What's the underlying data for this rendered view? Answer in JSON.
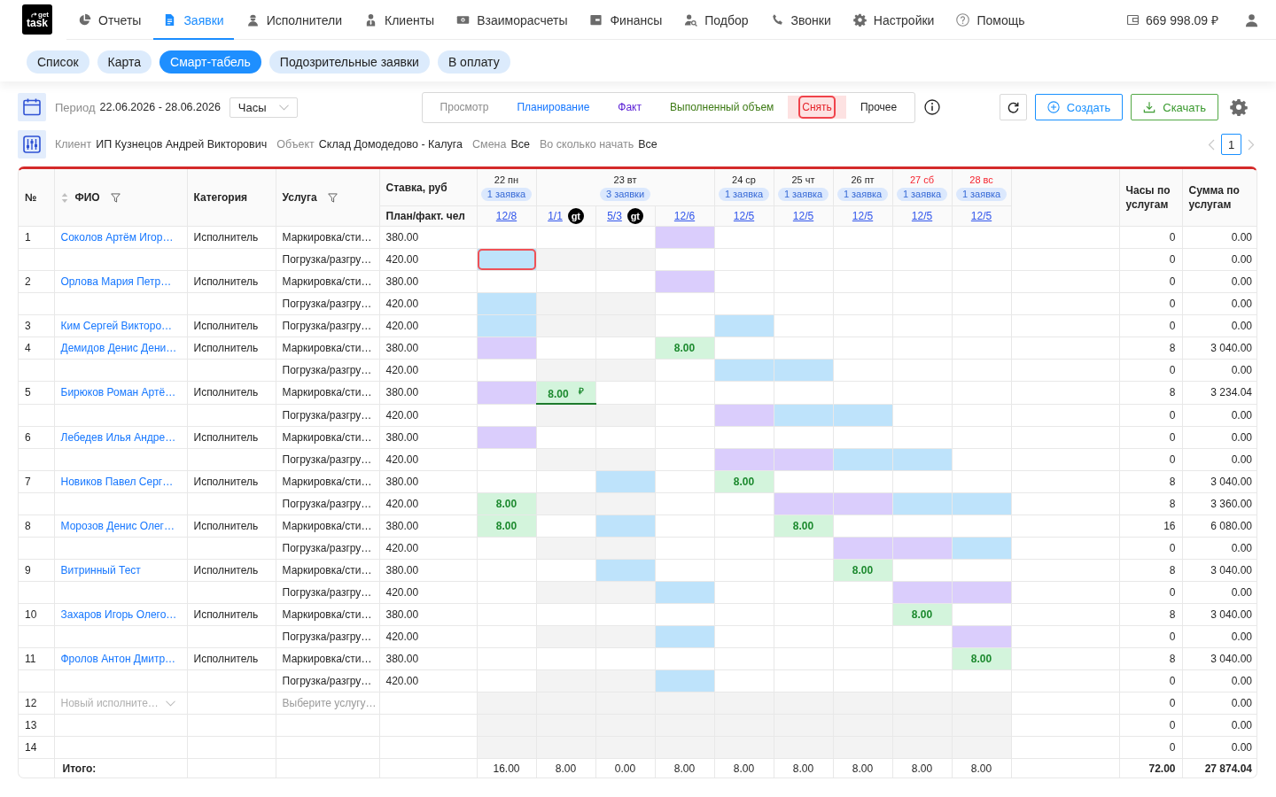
{
  "logo": {
    "top": "get",
    "bottom": "task"
  },
  "nav": {
    "items": [
      {
        "label": "Отчеты",
        "selected": false
      },
      {
        "label": "Заявки",
        "selected": true
      },
      {
        "label": "Исполнители",
        "selected": false
      },
      {
        "label": "Клиенты",
        "selected": false
      },
      {
        "label": "Взаиморасчеты",
        "selected": false
      },
      {
        "label": "Финансы",
        "selected": false
      },
      {
        "label": "Подбор",
        "selected": false
      },
      {
        "label": "Звонки",
        "selected": false
      },
      {
        "label": "Настройки",
        "selected": false
      },
      {
        "label": "Помощь",
        "selected": false
      }
    ]
  },
  "balance": {
    "amount": "669 998.09 ₽"
  },
  "subtabs": [
    {
      "label": "Список",
      "selected": false
    },
    {
      "label": "Карта",
      "selected": false
    },
    {
      "label": "Смарт-табель",
      "selected": true
    },
    {
      "label": "Подозрительные заявки",
      "selected": false
    },
    {
      "label": "В оплату",
      "selected": false
    }
  ],
  "toolbar": {
    "period": {
      "label": "Период",
      "value": "22.06.2026 - 28.06.2026"
    },
    "unit_select": {
      "value": "Часы"
    },
    "modes": [
      {
        "label": "Просмотр",
        "selected": false,
        "color": "#8c8c8c"
      },
      {
        "label": "Планирование",
        "selected": false,
        "color": "#1677ff"
      },
      {
        "label": "Факт",
        "selected": false,
        "color": "#5b21d6"
      },
      {
        "label": "Выполненный объем",
        "selected": false,
        "color": "#3d7a14"
      },
      {
        "label": "Снять",
        "selected": true,
        "color": "#e5242b"
      },
      {
        "label": "Прочее",
        "selected": false,
        "color": "#1f1f1f"
      }
    ],
    "create_button": "Создать",
    "download_button": "Скачать"
  },
  "filters": [
    {
      "label": "Клиент",
      "value": "ИП Кузнецов Андрей Викторович"
    },
    {
      "label": "Объект",
      "value": "Склад Домодедово - Калуга"
    },
    {
      "label": "Смена",
      "value": "Все"
    },
    {
      "label": "Во сколько начать",
      "value": "Все"
    }
  ],
  "pagination": {
    "pages": [
      {
        "label": "1",
        "selected": true
      }
    ]
  },
  "table": {
    "columns": {
      "number": "№",
      "name": "ФИО",
      "category": "Категория",
      "service": "Услуга",
      "rate": "Ставка, руб",
      "plan_fact": "План/факт. чел",
      "hours": "Часы по услугам",
      "sum": "Сумма по услугам"
    },
    "days": [
      {
        "label": "22 пн",
        "orders": "1 заявка",
        "weekend": false,
        "slots": [
          {
            "ratio": "12/8"
          }
        ]
      },
      {
        "label": "23 вт",
        "orders": "3 заявки",
        "weekend": false,
        "slots": [
          {
            "ratio": "1/1",
            "badge": "gt"
          },
          {
            "ratio": "5/3",
            "badge": "gt"
          },
          {
            "ratio": "12/6"
          }
        ]
      },
      {
        "label": "24 ср",
        "orders": "1 заявка",
        "weekend": false,
        "slots": [
          {
            "ratio": "12/5"
          }
        ]
      },
      {
        "label": "25 чт",
        "orders": "1 заявка",
        "weekend": false,
        "slots": [
          {
            "ratio": "12/5"
          }
        ]
      },
      {
        "label": "26 пт",
        "orders": "1 заявка",
        "weekend": false,
        "slots": [
          {
            "ratio": "12/5"
          }
        ]
      },
      {
        "label": "27 сб",
        "orders": "1 заявка",
        "weekend": true,
        "slots": [
          {
            "ratio": "12/5"
          }
        ]
      },
      {
        "label": "28 вс",
        "orders": "1 заявка",
        "weekend": true,
        "slots": [
          {
            "ratio": "12/5"
          }
        ]
      }
    ],
    "rows": [
      {
        "number": "1",
        "name": "Соколов Артём Игор…",
        "category": "Исполнитель",
        "service": "Маркировка/сти…",
        "rate": "380.00",
        "hours": "0",
        "sum": "0.00",
        "cells": [
          {
            "kind": "empty",
            "selected": false
          },
          {
            "kind": "empty",
            "selected": false
          },
          {
            "kind": "empty",
            "selected": false
          },
          {
            "kind": "fact",
            "selected": false
          },
          {
            "kind": "empty",
            "selected": false
          },
          {
            "kind": "empty",
            "selected": false
          },
          {
            "kind": "empty",
            "selected": false
          },
          {
            "kind": "empty",
            "selected": false
          },
          {
            "kind": "empty",
            "selected": false
          }
        ]
      },
      {
        "service": "Погрузка/разгру…",
        "rate": "420.00",
        "hours": "0",
        "sum": "0.00",
        "cells": [
          {
            "kind": "plan",
            "selected": true
          },
          {
            "kind": "unavailable",
            "selected": false
          },
          {
            "kind": "unavailable",
            "selected": false
          },
          {
            "kind": "empty",
            "selected": false
          },
          {
            "kind": "empty",
            "selected": false
          },
          {
            "kind": "empty",
            "selected": false
          },
          {
            "kind": "empty",
            "selected": false
          },
          {
            "kind": "empty",
            "selected": false
          },
          {
            "kind": "empty",
            "selected": false
          }
        ]
      },
      {
        "number": "2",
        "name": "Орлова Мария Петр…",
        "category": "Исполнитель",
        "service": "Маркировка/сти…",
        "rate": "380.00",
        "hours": "0",
        "sum": "0.00",
        "cells": [
          {
            "kind": "empty",
            "selected": false
          },
          {
            "kind": "empty",
            "selected": false
          },
          {
            "kind": "empty",
            "selected": false
          },
          {
            "kind": "fact",
            "selected": false
          },
          {
            "kind": "empty",
            "selected": false
          },
          {
            "kind": "empty",
            "selected": false
          },
          {
            "kind": "empty",
            "selected": false
          },
          {
            "kind": "empty",
            "selected": false
          },
          {
            "kind": "empty",
            "selected": false
          }
        ]
      },
      {
        "service": "Погрузка/разгру…",
        "rate": "420.00",
        "hours": "0",
        "sum": "0.00",
        "cells": [
          {
            "kind": "plan",
            "selected": false
          },
          {
            "kind": "unavailable",
            "selected": false
          },
          {
            "kind": "unavailable",
            "selected": false
          },
          {
            "kind": "empty",
            "selected": false
          },
          {
            "kind": "empty",
            "selected": false
          },
          {
            "kind": "empty",
            "selected": false
          },
          {
            "kind": "empty",
            "selected": false
          },
          {
            "kind": "empty",
            "selected": false
          },
          {
            "kind": "empty",
            "selected": false
          }
        ]
      },
      {
        "number": "3",
        "name": "Ким Сергей Викторо…",
        "category": "Исполнитель",
        "service": "Погрузка/разгру…",
        "rate": "420.00",
        "hours": "0",
        "sum": "0.00",
        "cells": [
          {
            "kind": "plan",
            "selected": false
          },
          {
            "kind": "unavailable",
            "selected": false
          },
          {
            "kind": "unavailable",
            "selected": false
          },
          {
            "kind": "empty",
            "selected": false
          },
          {
            "kind": "plan",
            "selected": false
          },
          {
            "kind": "empty",
            "selected": false
          },
          {
            "kind": "empty",
            "selected": false
          },
          {
            "kind": "empty",
            "selected": false
          },
          {
            "kind": "empty",
            "selected": false
          }
        ]
      },
      {
        "number": "4",
        "name": "Демидов Денис Дени…",
        "category": "Исполнитель",
        "service": "Маркировка/сти…",
        "rate": "380.00",
        "hours": "8",
        "sum": "3 040.00",
        "cells": [
          {
            "kind": "fact",
            "selected": false
          },
          {
            "kind": "empty",
            "selected": false
          },
          {
            "kind": "empty",
            "selected": false
          },
          {
            "kind": "volume",
            "value": "8.00",
            "selected": false
          },
          {
            "kind": "empty",
            "selected": false
          },
          {
            "kind": "empty",
            "selected": false
          },
          {
            "kind": "empty",
            "selected": false
          },
          {
            "kind": "empty",
            "selected": false
          },
          {
            "kind": "empty",
            "selected": false
          }
        ]
      },
      {
        "service": "Погрузка/разгру…",
        "rate": "420.00",
        "hours": "0",
        "sum": "0.00",
        "cells": [
          {
            "kind": "empty",
            "selected": false
          },
          {
            "kind": "unavailable",
            "selected": false
          },
          {
            "kind": "unavailable",
            "selected": false
          },
          {
            "kind": "empty",
            "selected": false
          },
          {
            "kind": "plan",
            "selected": false
          },
          {
            "kind": "plan",
            "selected": false
          },
          {
            "kind": "empty",
            "selected": false
          },
          {
            "kind": "empty",
            "selected": false
          },
          {
            "kind": "empty",
            "selected": false
          }
        ]
      },
      {
        "number": "5",
        "name": "Бирюков Роман Артё…",
        "category": "Исполнитель",
        "service": "Маркировка/сти…",
        "rate": "380.00",
        "hours": "8",
        "sum": "3 234.04",
        "cells": [
          {
            "kind": "fact",
            "selected": false
          },
          {
            "kind": "volume",
            "value": "8.00",
            "currency": "₽",
            "selected": false
          },
          {
            "kind": "empty",
            "selected": false
          },
          {
            "kind": "empty",
            "selected": false
          },
          {
            "kind": "empty",
            "selected": false
          },
          {
            "kind": "empty",
            "selected": false
          },
          {
            "kind": "empty",
            "selected": false
          },
          {
            "kind": "empty",
            "selected": false
          },
          {
            "kind": "empty",
            "selected": false
          }
        ]
      },
      {
        "service": "Погрузка/разгру…",
        "rate": "420.00",
        "hours": "0",
        "sum": "0.00",
        "cells": [
          {
            "kind": "empty",
            "selected": false
          },
          {
            "kind": "unavailable",
            "selected": false
          },
          {
            "kind": "unavailable",
            "selected": false
          },
          {
            "kind": "empty",
            "selected": false
          },
          {
            "kind": "fact",
            "selected": false
          },
          {
            "kind": "plan",
            "selected": false
          },
          {
            "kind": "plan",
            "selected": false
          },
          {
            "kind": "empty",
            "selected": false
          },
          {
            "kind": "empty",
            "selected": false
          }
        ]
      },
      {
        "number": "6",
        "name": "Лебедев Илья Андре…",
        "category": "Исполнитель",
        "service": "Маркировка/сти…",
        "rate": "380.00",
        "hours": "0",
        "sum": "0.00",
        "cells": [
          {
            "kind": "fact",
            "selected": false
          },
          {
            "kind": "empty",
            "selected": false
          },
          {
            "kind": "empty",
            "selected": false
          },
          {
            "kind": "empty",
            "selected": false
          },
          {
            "kind": "empty",
            "selected": false
          },
          {
            "kind": "empty",
            "selected": false
          },
          {
            "kind": "empty",
            "selected": false
          },
          {
            "kind": "empty",
            "selected": false
          },
          {
            "kind": "empty",
            "selected": false
          }
        ]
      },
      {
        "service": "Погрузка/разгру…",
        "rate": "420.00",
        "hours": "0",
        "sum": "0.00",
        "cells": [
          {
            "kind": "empty",
            "selected": false
          },
          {
            "kind": "unavailable",
            "selected": false
          },
          {
            "kind": "unavailable",
            "selected": false
          },
          {
            "kind": "empty",
            "selected": false
          },
          {
            "kind": "fact",
            "selected": false
          },
          {
            "kind": "fact",
            "selected": false
          },
          {
            "kind": "plan",
            "selected": false
          },
          {
            "kind": "plan",
            "selected": false
          },
          {
            "kind": "empty",
            "selected": false
          }
        ]
      },
      {
        "number": "7",
        "name": "Новиков Павел Серг…",
        "category": "Исполнитель",
        "service": "Маркировка/сти…",
        "rate": "380.00",
        "hours": "8",
        "sum": "3 040.00",
        "cells": [
          {
            "kind": "empty",
            "selected": false
          },
          {
            "kind": "empty",
            "selected": false
          },
          {
            "kind": "plan",
            "selected": false
          },
          {
            "kind": "empty",
            "selected": false
          },
          {
            "kind": "volume",
            "value": "8.00",
            "selected": false
          },
          {
            "kind": "empty",
            "selected": false
          },
          {
            "kind": "empty",
            "selected": false
          },
          {
            "kind": "empty",
            "selected": false
          },
          {
            "kind": "empty",
            "selected": false
          }
        ]
      },
      {
        "service": "Погрузка/разгру…",
        "rate": "420.00",
        "hours": "8",
        "sum": "3 360.00",
        "cells": [
          {
            "kind": "volume",
            "value": "8.00",
            "selected": false
          },
          {
            "kind": "unavailable",
            "selected": false
          },
          {
            "kind": "unavailable",
            "selected": false
          },
          {
            "kind": "empty",
            "selected": false
          },
          {
            "kind": "empty",
            "selected": false
          },
          {
            "kind": "fact",
            "selected": false
          },
          {
            "kind": "fact",
            "selected": false
          },
          {
            "kind": "plan",
            "selected": false
          },
          {
            "kind": "plan",
            "selected": false
          }
        ]
      },
      {
        "number": "8",
        "name": "Морозов Денис Олег…",
        "category": "Исполнитель",
        "service": "Маркировка/сти…",
        "rate": "380.00",
        "hours": "16",
        "sum": "6 080.00",
        "cells": [
          {
            "kind": "volume",
            "value": "8.00",
            "selected": false
          },
          {
            "kind": "empty",
            "selected": false
          },
          {
            "kind": "plan",
            "selected": false
          },
          {
            "kind": "empty",
            "selected": false
          },
          {
            "kind": "empty",
            "selected": false
          },
          {
            "kind": "volume",
            "value": "8.00",
            "selected": false
          },
          {
            "kind": "empty",
            "selected": false
          },
          {
            "kind": "empty",
            "selected": false
          },
          {
            "kind": "empty",
            "selected": false
          }
        ]
      },
      {
        "service": "Погрузка/разгру…",
        "rate": "420.00",
        "hours": "0",
        "sum": "0.00",
        "cells": [
          {
            "kind": "empty",
            "selected": false
          },
          {
            "kind": "unavailable",
            "selected": false
          },
          {
            "kind": "unavailable",
            "selected": false
          },
          {
            "kind": "empty",
            "selected": false
          },
          {
            "kind": "empty",
            "selected": false
          },
          {
            "kind": "empty",
            "selected": false
          },
          {
            "kind": "fact",
            "selected": false
          },
          {
            "kind": "fact",
            "selected": false
          },
          {
            "kind": "plan",
            "selected": false
          }
        ]
      },
      {
        "number": "9",
        "name": "Витринный Тест",
        "category": "Исполнитель",
        "service": "Маркировка/сти…",
        "rate": "380.00",
        "hours": "8",
        "sum": "3 040.00",
        "cells": [
          {
            "kind": "empty",
            "selected": false
          },
          {
            "kind": "empty",
            "selected": false
          },
          {
            "kind": "plan",
            "selected": false
          },
          {
            "kind": "empty",
            "selected": false
          },
          {
            "kind": "empty",
            "selected": false
          },
          {
            "kind": "empty",
            "selected": false
          },
          {
            "kind": "volume",
            "value": "8.00",
            "selected": false
          },
          {
            "kind": "empty",
            "selected": false
          },
          {
            "kind": "empty",
            "selected": false
          }
        ]
      },
      {
        "service": "Погрузка/разгру…",
        "rate": "420.00",
        "hours": "0",
        "sum": "0.00",
        "cells": [
          {
            "kind": "empty",
            "selected": false
          },
          {
            "kind": "unavailable",
            "selected": false
          },
          {
            "kind": "unavailable",
            "selected": false
          },
          {
            "kind": "plan",
            "selected": false
          },
          {
            "kind": "empty",
            "selected": false
          },
          {
            "kind": "empty",
            "selected": false
          },
          {
            "kind": "empty",
            "selected": false
          },
          {
            "kind": "fact",
            "selected": false
          },
          {
            "kind": "fact",
            "selected": false
          }
        ]
      },
      {
        "number": "10",
        "name": "Захаров Игорь Олего…",
        "category": "Исполнитель",
        "service": "Маркировка/сти…",
        "rate": "380.00",
        "hours": "8",
        "sum": "3 040.00",
        "cells": [
          {
            "kind": "empty",
            "selected": false
          },
          {
            "kind": "empty",
            "selected": false
          },
          {
            "kind": "empty",
            "selected": false
          },
          {
            "kind": "empty",
            "selected": false
          },
          {
            "kind": "empty",
            "selected": false
          },
          {
            "kind": "empty",
            "selected": false
          },
          {
            "kind": "empty",
            "selected": false
          },
          {
            "kind": "volume",
            "value": "8.00",
            "selected": false
          },
          {
            "kind": "empty",
            "selected": false
          }
        ]
      },
      {
        "service": "Погрузка/разгру…",
        "rate": "420.00",
        "hours": "0",
        "sum": "0.00",
        "cells": [
          {
            "kind": "empty",
            "selected": false
          },
          {
            "kind": "unavailable",
            "selected": false
          },
          {
            "kind": "unavailable",
            "selected": false
          },
          {
            "kind": "plan",
            "selected": false
          },
          {
            "kind": "empty",
            "selected": false
          },
          {
            "kind": "empty",
            "selected": false
          },
          {
            "kind": "empty",
            "selected": false
          },
          {
            "kind": "empty",
            "selected": false
          },
          {
            "kind": "fact",
            "selected": false
          }
        ]
      },
      {
        "number": "11",
        "name": "Фролов Антон Дмитр…",
        "category": "Исполнитель",
        "service": "Маркировка/сти…",
        "rate": "380.00",
        "hours": "8",
        "sum": "3 040.00",
        "cells": [
          {
            "kind": "empty",
            "selected": false
          },
          {
            "kind": "empty",
            "selected": false
          },
          {
            "kind": "empty",
            "selected": false
          },
          {
            "kind": "empty",
            "selected": false
          },
          {
            "kind": "empty",
            "selected": false
          },
          {
            "kind": "empty",
            "selected": false
          },
          {
            "kind": "empty",
            "selected": false
          },
          {
            "kind": "empty",
            "selected": false
          },
          {
            "kind": "volume",
            "value": "8.00",
            "selected": false
          }
        ]
      },
      {
        "service": "Погрузка/разгру…",
        "rate": "420.00",
        "hours": "0",
        "sum": "0.00",
        "cells": [
          {
            "kind": "empty",
            "selected": false
          },
          {
            "kind": "unavailable",
            "selected": false
          },
          {
            "kind": "unavailable",
            "selected": false
          },
          {
            "kind": "plan",
            "selected": false
          },
          {
            "kind": "empty",
            "selected": false
          },
          {
            "kind": "empty",
            "selected": false
          },
          {
            "kind": "empty",
            "selected": false
          },
          {
            "kind": "empty",
            "selected": false
          },
          {
            "kind": "empty",
            "selected": false
          }
        ]
      },
      {
        "number": "12",
        "name_select": {
          "placeholder": "Новый исполните…"
        },
        "service_select": {
          "placeholder": "Выберите услугу…"
        },
        "hours": "0",
        "sum": "0.00",
        "cells": [
          {
            "kind": "unavailable",
            "selected": false
          },
          {
            "kind": "unavailable",
            "selected": false
          },
          {
            "kind": "unavailable",
            "selected": false
          },
          {
            "kind": "unavailable",
            "selected": false
          },
          {
            "kind": "unavailable",
            "selected": false
          },
          {
            "kind": "unavailable",
            "selected": false
          },
          {
            "kind": "unavailable",
            "selected": false
          },
          {
            "kind": "unavailable",
            "selected": false
          },
          {
            "kind": "unavailable",
            "selected": false
          }
        ]
      },
      {
        "number": "13",
        "hours": "0",
        "sum": "0.00",
        "cells": [
          {
            "kind": "unavailable",
            "selected": false
          },
          {
            "kind": "unavailable",
            "selected": false
          },
          {
            "kind": "unavailable",
            "selected": false
          },
          {
            "kind": "unavailable",
            "selected": false
          },
          {
            "kind": "unavailable",
            "selected": false
          },
          {
            "kind": "unavailable",
            "selected": false
          },
          {
            "kind": "unavailable",
            "selected": false
          },
          {
            "kind": "unavailable",
            "selected": false
          },
          {
            "kind": "unavailable",
            "selected": false
          }
        ]
      },
      {
        "number": "14",
        "hours": "0",
        "sum": "0.00",
        "cells": [
          {
            "kind": "unavailable",
            "selected": false
          },
          {
            "kind": "unavailable",
            "selected": false
          },
          {
            "kind": "unavailable",
            "selected": false
          },
          {
            "kind": "unavailable",
            "selected": false
          },
          {
            "kind": "unavailable",
            "selected": false
          },
          {
            "kind": "unavailable",
            "selected": false
          },
          {
            "kind": "unavailable",
            "selected": false
          },
          {
            "kind": "unavailable",
            "selected": false
          },
          {
            "kind": "unavailable",
            "selected": false
          }
        ]
      }
    ],
    "totals": {
      "label": "Итого:",
      "days": [
        "16.00",
        "8.00",
        "0.00",
        "8.00",
        "8.00",
        "8.00",
        "8.00",
        "8.00",
        "8.00"
      ],
      "hours": "72.00",
      "sum": "27 874.04"
    }
  }
}
